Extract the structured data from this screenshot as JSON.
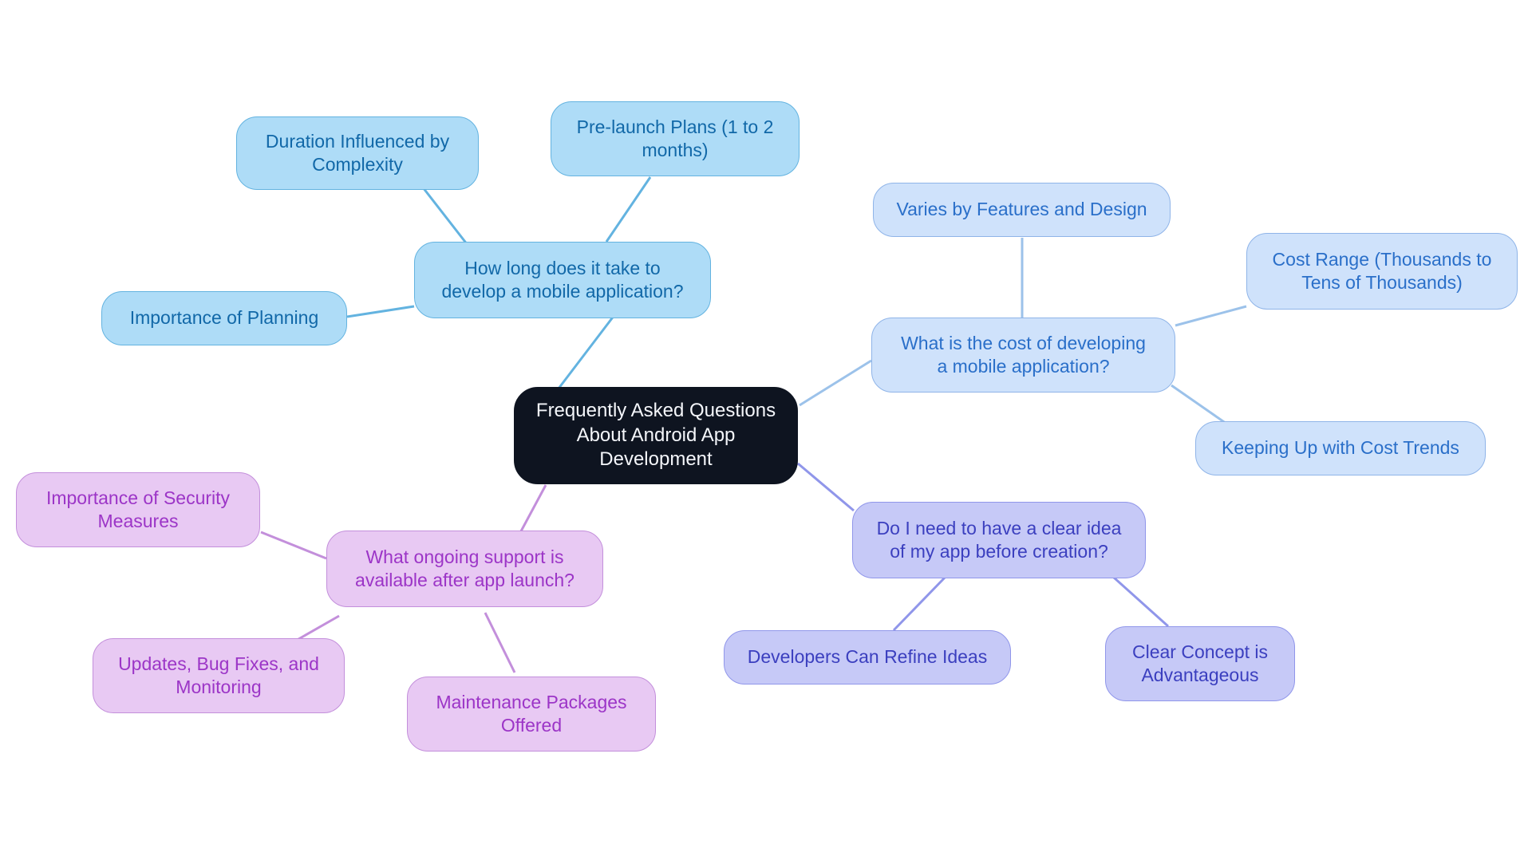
{
  "diagram": {
    "type": "mind-map",
    "background_color": "#ffffff",
    "root": {
      "id": "root",
      "label": "Frequently Asked Questions\nAbout Android App\nDevelopment",
      "fill": "#0e1420",
      "text_color": "#f4f6fa"
    },
    "branches": [
      {
        "id": "branch-duration",
        "label": "How long does it take to\ndevelop a mobile application?",
        "fill": "#aedcf7",
        "border": "#63b3e0",
        "text_color": "#1168a8",
        "children": [
          {
            "id": "child-duration-complexity",
            "label": "Duration Influenced by\nComplexity"
          },
          {
            "id": "child-prelaunch-plans",
            "label": "Pre-launch Plans (1 to 2\nmonths)"
          },
          {
            "id": "child-importance-planning",
            "label": "Importance of Planning"
          }
        ]
      },
      {
        "id": "branch-cost",
        "label": "What is the cost of developing\na mobile application?",
        "fill": "#cfe2fb",
        "border": "#8fb4e8",
        "text_color": "#2a6fc9",
        "children": [
          {
            "id": "child-varies-features",
            "label": "Varies by Features and Design"
          },
          {
            "id": "child-cost-range",
            "label": "Cost Range (Thousands to\nTens of Thousands)"
          },
          {
            "id": "child-cost-trends",
            "label": "Keeping Up with Cost Trends"
          }
        ]
      },
      {
        "id": "branch-clear-idea",
        "label": "Do I need to have a clear idea\nof my app before creation?",
        "fill": "#c6c9f7",
        "border": "#9096ea",
        "text_color": "#3b3fbf",
        "children": [
          {
            "id": "child-refine-ideas",
            "label": "Developers Can Refine Ideas"
          },
          {
            "id": "child-clear-concept",
            "label": "Clear Concept is\nAdvantageous"
          }
        ]
      },
      {
        "id": "branch-support",
        "label": "What ongoing support is\navailable after app launch?",
        "fill": "#e8c9f3",
        "border": "#c38fdb",
        "text_color": "#9c35c7",
        "children": [
          {
            "id": "child-security-measures",
            "label": "Importance of Security\nMeasures"
          },
          {
            "id": "child-updates-bugfixes",
            "label": "Updates, Bug Fixes, and\nMonitoring"
          },
          {
            "id": "child-maintenance-packages",
            "label": "Maintenance Packages\nOffered"
          }
        ]
      }
    ]
  }
}
